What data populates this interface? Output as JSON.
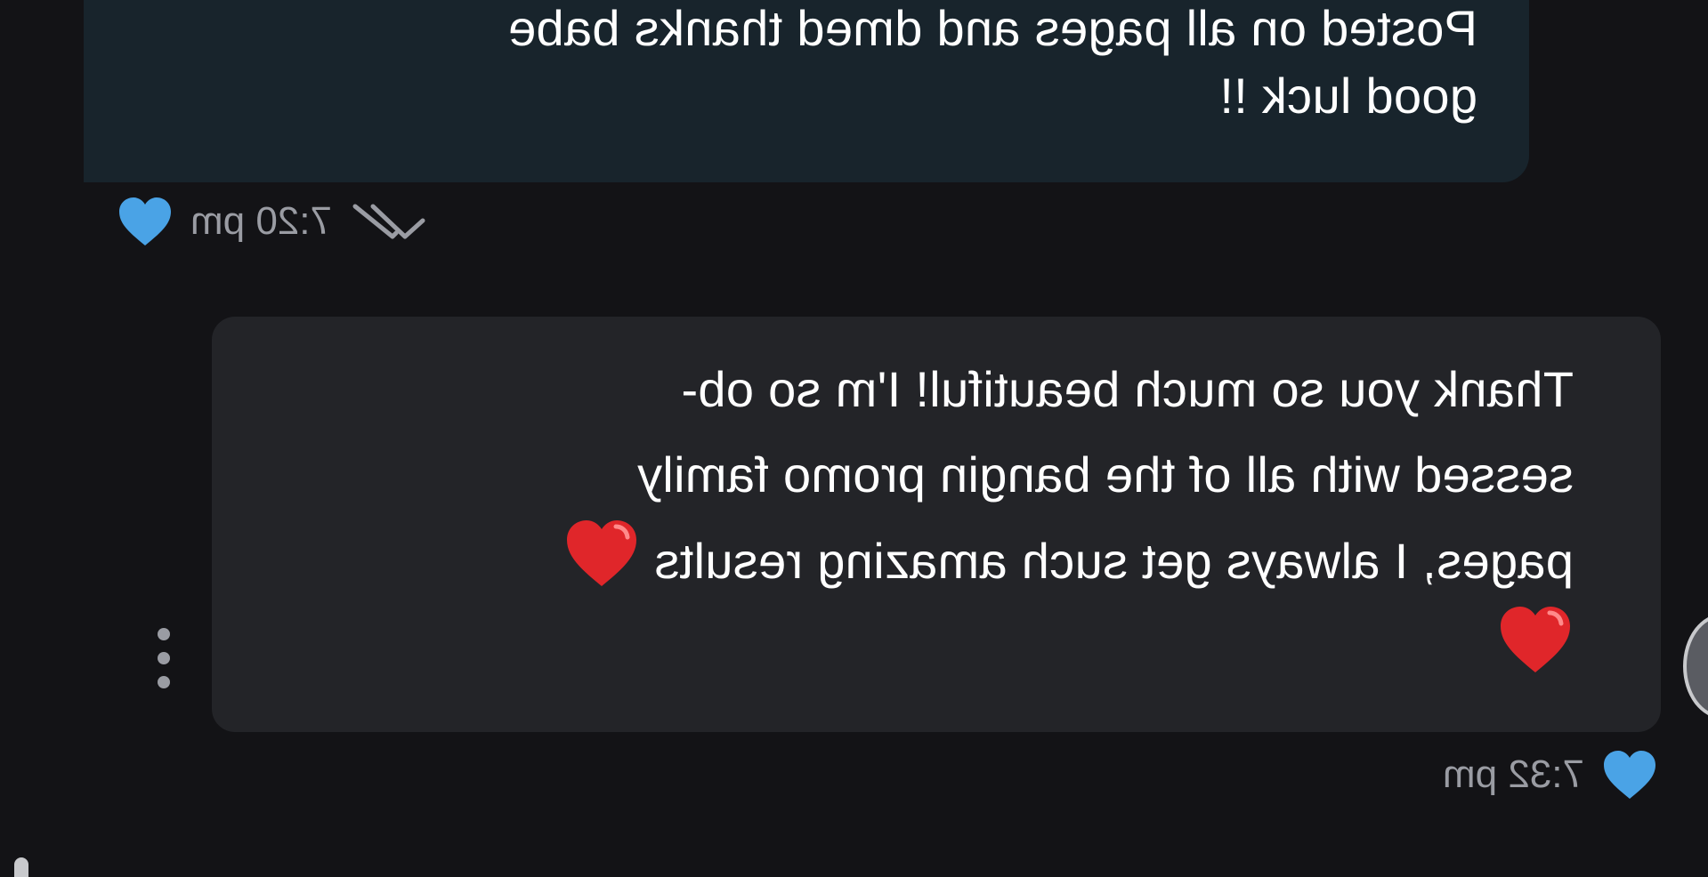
{
  "messages": [
    {
      "id": "sent",
      "lines": [
        "Posted on all pages and dmed thanks babe",
        "good luck !!"
      ],
      "time": "7:20 pm",
      "reaction_icon": "blue-heart-icon",
      "status_icon": "double-check-icon"
    },
    {
      "id": "received",
      "lines": [
        "Thank you so much beautiful! I'm so ob-",
        "sessed with all of the bangin promo family",
        "pages, I always get such amazing results"
      ],
      "time": "7:32 pm",
      "reaction_icon": "blue-heart-icon",
      "emoji_icon": "red-heart-icon"
    }
  ],
  "colors": {
    "background": "#131316",
    "sent_bubble": "#18242c",
    "received_bubble": "#232428",
    "meta_text": "#9a9ca3",
    "reaction_heart": "#4aa3e6",
    "emoji_heart": "#e0262a"
  }
}
